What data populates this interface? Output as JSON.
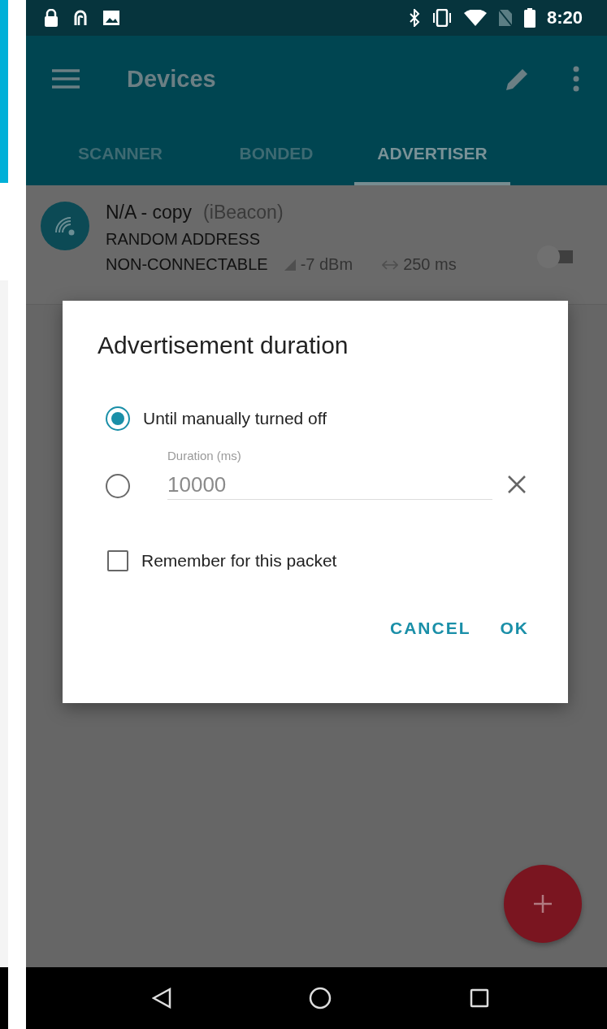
{
  "status_bar": {
    "time": "8:20"
  },
  "toolbar": {
    "title": "Devices"
  },
  "tabs": [
    {
      "label": "SCANNER",
      "selected": false
    },
    {
      "label": "BONDED",
      "selected": false
    },
    {
      "label": "ADVERTISER",
      "selected": true
    }
  ],
  "advertisements": [
    {
      "name": "N/A - copy",
      "type": "(iBeacon)",
      "address": "RANDOM ADDRESS",
      "connectable": "NON-CONNECTABLE",
      "tx_power": "-7 dBm",
      "interval": "250 ms",
      "on": false
    }
  ],
  "dialog": {
    "title": "Advertisement duration",
    "options": [
      {
        "kind": "text",
        "label": "Until manually turned off",
        "selected": true
      },
      {
        "kind": "field",
        "label": "Duration (ms)",
        "value": "10000",
        "disabled": true,
        "selected": false
      }
    ],
    "remember": {
      "label": "Remember for this packet",
      "checked": false
    },
    "buttons": [
      "CANCEL",
      "OK"
    ]
  }
}
